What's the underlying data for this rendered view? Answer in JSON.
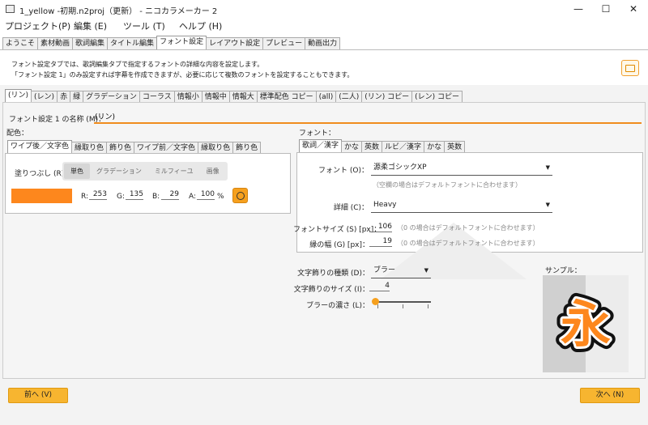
{
  "window": {
    "title": "1_yellow -初期.n2proj（更新） - ニコカラメーカー 2",
    "controls": [
      "minimize",
      "maximize",
      "close"
    ]
  },
  "menu": [
    "プロジェクト(P)",
    "編集 (E)",
    "ツール (T)",
    "ヘルプ (H)"
  ],
  "main_tabs": [
    "ようこそ",
    "素材動画",
    "歌詞編集",
    "タイトル編集",
    "フォント設定",
    "レイアウト設定",
    "プレビュー",
    "動画出力"
  ],
  "main_tab_active": 4,
  "description": {
    "line1": "フォント設定タブでは、歌詞編集タブで指定するフォントの詳細な内容を設定します。",
    "line2": "「フォント設定 1」のみ設定すれば字幕を作成できますが、必要に応じて複数のフォントを設定することもできます。"
  },
  "font_tabs": [
    "(リン)",
    "(レン)",
    "赤",
    "緑",
    "グラデーション",
    "コーラス",
    "情報小",
    "情報中",
    "情報大",
    "標準配色 コピー",
    "(all)",
    "(二人)",
    "(リン) コピー",
    "(レン) コピー"
  ],
  "font_tab_active": 0,
  "font_name": {
    "label": "フォント設定 1 の名称 (M)：",
    "value": "(リン)"
  },
  "color": {
    "label": "配色：",
    "tabs": [
      "ワイプ後／文字色",
      "縁取り色",
      "飾り色",
      "ワイプ前／文字色",
      "縁取り色",
      "飾り色"
    ],
    "active": 0,
    "fill_label": "塗りつぶし (R)：",
    "fill_modes": [
      "単色",
      "グラデーション",
      "ミルフィーユ",
      "画像"
    ],
    "fill_mode_selected": 0,
    "swatch": "#FD871D",
    "r_label": "R:",
    "r": "253",
    "g_label": "G:",
    "g": "135",
    "b_label": "B:",
    "b": "29",
    "a_label": "A:",
    "a": "100",
    "a_unit": "%"
  },
  "font": {
    "label": "フォント：",
    "tabs": [
      "歌詞／漢字",
      "かな",
      "英数",
      "ルビ／漢字",
      "かな",
      "英数"
    ],
    "active": 0,
    "face_label": "フォント (O)：",
    "face_value": "源柔ゴシックXP",
    "face_hint": "（空欄の場合はデフォルトフォントに合わせます）",
    "weight_label": "詳細 (C)：",
    "weight_value": "Heavy",
    "size_label": "フォントサイズ (S) [px]：",
    "size_value": "106",
    "size_hint": "（0 の場合はデフォルトフォントに合わせます）",
    "edge_label": "縁の幅 (G) [px]：",
    "edge_value": "19",
    "edge_hint": "（0 の場合はデフォルトフォントに合わせます）"
  },
  "decoration": {
    "type_label": "文字飾りの種類 (D)：",
    "type_value": "ブラー",
    "size_label": "文字飾りのサイズ (I)：",
    "size_value": "4",
    "blur_label": "ブラーの濃さ (L)：",
    "blur_level": 0.0
  },
  "sample": {
    "label": "サンプル：",
    "glyph": "永"
  },
  "nav": {
    "prev": "前へ (V)",
    "next": "次へ (N)"
  },
  "colors": {
    "accent": "#F08C1E",
    "button": "#F7B530"
  }
}
